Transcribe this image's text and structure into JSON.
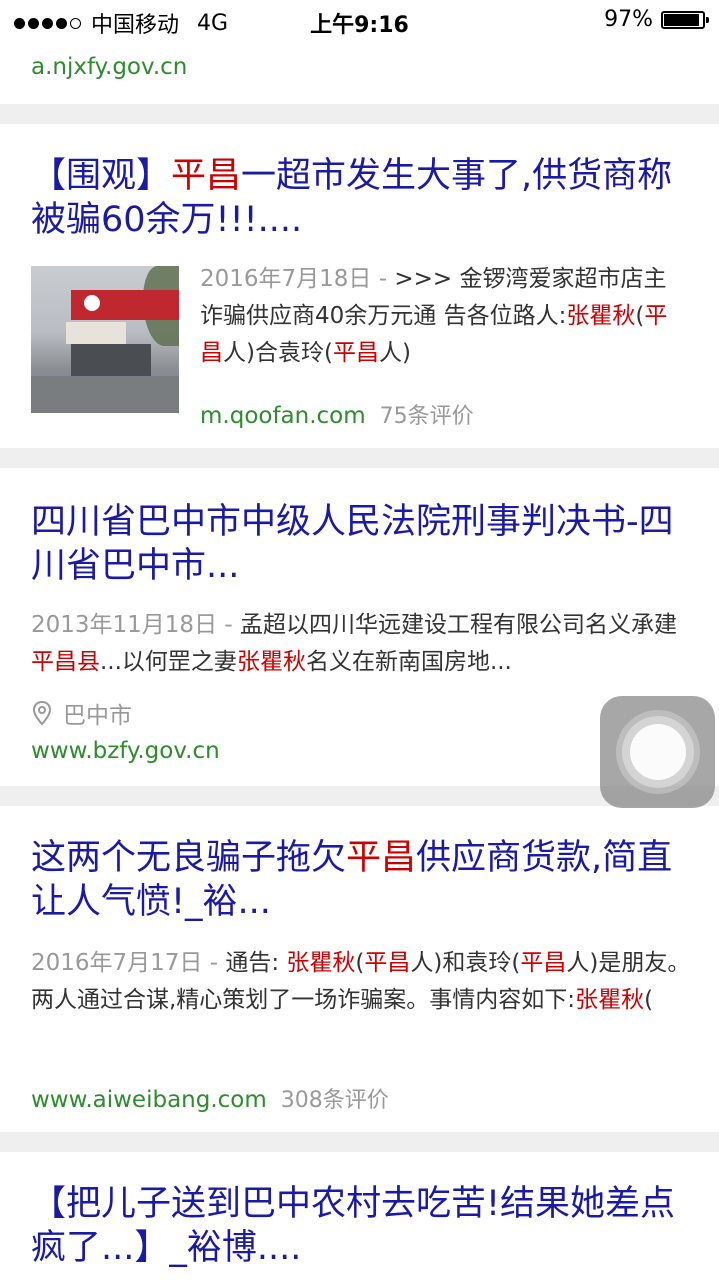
{
  "status_bar": {
    "carrier": "中国移动",
    "network": "4G",
    "time": "上午9:16",
    "battery": "97%",
    "battery_level": 0.97
  },
  "result0": {
    "url": "a.njxfy.gov.cn"
  },
  "result1": {
    "title_a": "【围观】",
    "title_hl": "平昌",
    "title_b": "一超市发生大事了,供货商称被骗60余万!!!....",
    "date": "2016年7月18日 - ",
    "snippet_a": ">>> 金锣湾爱家超市店主诈骗供应商40余万元通 告各位路人:",
    "hl1": "张瞿秋",
    "snippet_b": "(",
    "hl2": "平昌",
    "snippet_c": "人)合袁玲(",
    "hl3": "平昌",
    "snippet_d": "人)",
    "url": "m.qoofan.com",
    "comments": "75条评价"
  },
  "result2": {
    "title": "四川省巴中市中级人民法院刑事判决书-四川省巴中市...",
    "date": "2013年11月18日 - ",
    "snippet_a": "孟超以四川华远建设工程有限公司名义承建",
    "hl1": "平昌县",
    "snippet_b": "...以何罡之妻",
    "hl2": "张瞿秋",
    "snippet_c": "名义在新南国房地...",
    "location": "巴中市",
    "url": "www.bzfy.gov.cn"
  },
  "result3": {
    "title_a": "这两个无良骗子拖欠",
    "title_hl": "平昌",
    "title_b": "供应商货款,简直让人气愤!_裕...",
    "date": "2016年7月17日 - ",
    "snippet_a": "通告: ",
    "hl1": "张瞿秋",
    "snippet_b": "(",
    "hl2": "平昌",
    "snippet_c": "人)和袁玲(",
    "hl3": "平昌",
    "snippet_d": "人)是朋友。两人通过合谋,精心策划了一场诈骗案。事情内容如下:",
    "hl4": "张瞿秋",
    "snippet_e": "(",
    "url": "www.aiweibang.com",
    "comments": "308条评价"
  },
  "result4": {
    "title": "【把儿子送到巴中农村去吃苦!结果她差点疯了...】_裕博...."
  }
}
